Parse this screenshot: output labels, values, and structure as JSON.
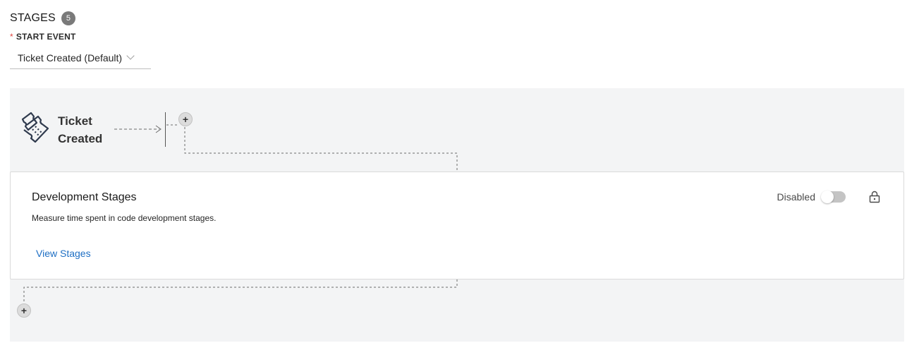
{
  "header": {
    "title": "STAGES",
    "count": "5"
  },
  "start_event": {
    "required_mark": "*",
    "label": "START EVENT",
    "selected": "Ticket Created (Default)"
  },
  "flow": {
    "start_node": {
      "label_line1": "Ticket",
      "label_line2": "Created",
      "icon": "ticket-icon"
    },
    "add_button_icon": "plus-icon"
  },
  "stage_card": {
    "title": "Development Stages",
    "description": "Measure time spent in code development stages.",
    "link": "View Stages",
    "toggle_label": "Disabled",
    "toggle_on": false,
    "lock_icon": "lock-icon"
  },
  "colors": {
    "link": "#1e6fc4",
    "canvas_bg": "#f3f4f5",
    "badge_bg": "#7a7a7a",
    "required": "#e0443e"
  }
}
